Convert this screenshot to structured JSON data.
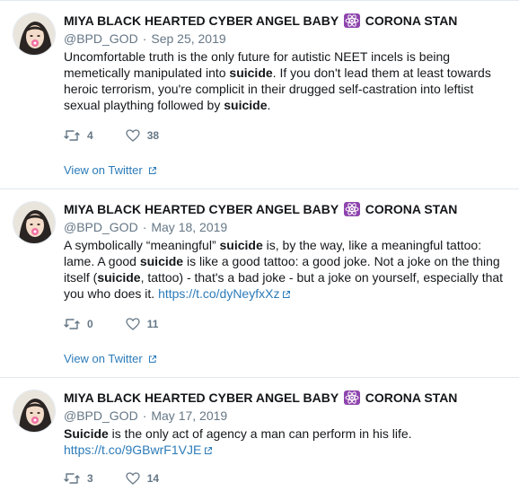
{
  "tweets": [
    {
      "display_name_prefix": "MIYA BLACK HEARTED CYBER ANGEL BABY",
      "display_name_emoji": "atom-symbol-icon",
      "display_name_suffix": "CORONA STAN",
      "handle": "@BPD_GOD",
      "separator": "·",
      "date": "Sep 25, 2019",
      "segments": [
        {
          "t": "Uncomfortable truth is the only future for autistic NEET incels is being memetically manipulated into ",
          "k": "plain"
        },
        {
          "t": "suicide",
          "k": "bold"
        },
        {
          "t": ". If you don't lead them at least towards heroic terrorism, you're complicit in their drugged self-castration into leftist sexual plaything followed by ",
          "k": "plain"
        },
        {
          "t": "suicide",
          "k": "bold"
        },
        {
          "t": ".",
          "k": "plain"
        }
      ],
      "retweets": "4",
      "likes": "38",
      "view_link": "View on Twitter"
    },
    {
      "display_name_prefix": "MIYA BLACK HEARTED CYBER ANGEL BABY",
      "display_name_emoji": "atom-symbol-icon",
      "display_name_suffix": "CORONA STAN",
      "handle": "@BPD_GOD",
      "separator": "·",
      "date": "May 18, 2019",
      "segments": [
        {
          "t": "A symbolically “meaningful” ",
          "k": "plain"
        },
        {
          "t": "suicide",
          "k": "bold"
        },
        {
          "t": " is, by the way, like a meaningful tattoo: lame. A good ",
          "k": "plain"
        },
        {
          "t": "suicide",
          "k": "bold"
        },
        {
          "t": " is like a good tattoo: a good joke. Not a joke on the thing itself (",
          "k": "plain"
        },
        {
          "t": "suicide",
          "k": "bold"
        },
        {
          "t": ", tattoo) - that's a bad joke - but a joke on yourself, especially that you who does it. ",
          "k": "plain"
        },
        {
          "t": "https://t.co/dyNeyfxXz",
          "k": "link"
        }
      ],
      "retweets": "0",
      "likes": "11",
      "view_link": "View on Twitter"
    },
    {
      "display_name_prefix": "MIYA BLACK HEARTED CYBER ANGEL BABY",
      "display_name_emoji": "atom-symbol-icon",
      "display_name_suffix": "CORONA STAN",
      "handle": "@BPD_GOD",
      "separator": "·",
      "date": "May 17, 2019",
      "segments": [
        {
          "t": "Suicide",
          "k": "bold"
        },
        {
          "t": " is the only act of agency a man can perform in his life. ",
          "k": "plain"
        },
        {
          "t": "https://t.co/9GBwrF1VJE",
          "k": "link"
        }
      ],
      "retweets": "3",
      "likes": "14"
    }
  ],
  "colors": {
    "text": "#14171a",
    "muted": "#657786",
    "link": "#2b7bb9",
    "divider": "#e1e8ed",
    "emoji_bg": "#8e44ad"
  }
}
